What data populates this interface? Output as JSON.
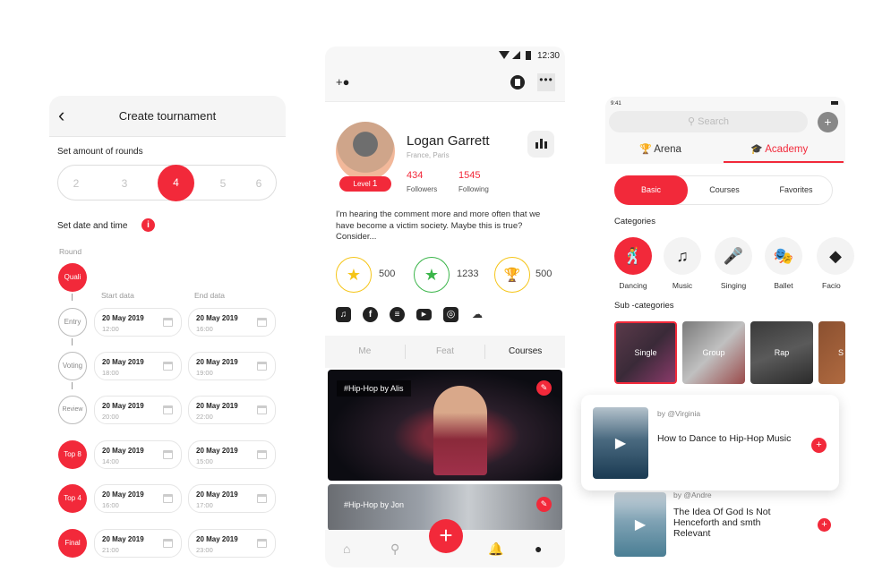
{
  "tournament": {
    "title": "Create tournament",
    "rounds_label": "Set amount of rounds",
    "round_options": [
      "2",
      "3",
      "4",
      "5",
      "6"
    ],
    "selected_rounds": "4",
    "date_label": "Set date and time",
    "info_icon": "i",
    "round_col_label": "Round",
    "start_col_label": "Start data",
    "end_col_label": "End data",
    "rounds": [
      {
        "name": "Quali",
        "style": "filled"
      },
      {
        "name": "Entry",
        "style": "outline",
        "start_date": "20 May 2019",
        "start_time": "12:00",
        "end_date": "20 May 2019",
        "end_time": "16:00"
      },
      {
        "name": "Voting",
        "style": "outline",
        "start_date": "20 May 2019",
        "start_time": "18:00",
        "end_date": "20 May 2019",
        "end_time": "19:00"
      },
      {
        "name": "Review",
        "style": "outline",
        "start_date": "20 May 2019",
        "start_time": "20:00",
        "end_date": "20 May 2019",
        "end_time": "22:00"
      },
      {
        "name": "Top 8",
        "style": "filled",
        "start_date": "20 May 2019",
        "start_time": "14:00",
        "end_date": "20 May 2019",
        "end_time": "15:00"
      },
      {
        "name": "Top 4",
        "style": "filled",
        "start_date": "20 May 2019",
        "start_time": "16:00",
        "end_date": "20 May 2019",
        "end_time": "17:00"
      },
      {
        "name": "Final",
        "style": "filled",
        "start_date": "20 May 2019",
        "start_time": "21:00",
        "end_date": "20 May 2019",
        "end_time": "23:00"
      }
    ]
  },
  "profile": {
    "status_time": "12:30",
    "name": "Logan Garrett",
    "location": "France, Paris",
    "level_label": "Level",
    "level_value": "1",
    "followers_count": "434",
    "followers_label": "Followers",
    "following_count": "1545",
    "following_label": "Following",
    "bio": "I'm hearing the comment more and more often that we have become a victim society. Maybe this is true? Consider...",
    "badges": [
      {
        "icon": "★",
        "value": "500",
        "color": "#f5c518"
      },
      {
        "icon": "★",
        "value": "1233",
        "color": "#3bb54a"
      },
      {
        "icon": "🏆",
        "value": "500",
        "color": "#f5c518"
      }
    ],
    "socials": [
      "apple-music",
      "facebook",
      "spotify",
      "youtube",
      "instagram",
      "soundcloud"
    ],
    "tabs": [
      "Me",
      "Feat",
      "Courses"
    ],
    "active_tab": "Courses",
    "posts": [
      {
        "tag": "#Hip-Hop by Alis"
      },
      {
        "tag": "#Hip-Hop by Jon"
      }
    ],
    "nav": [
      "home",
      "search",
      "add",
      "notifications",
      "profile"
    ]
  },
  "academy": {
    "status_time": "9:41",
    "search_placeholder": "Search",
    "top_tabs": [
      "Arena",
      "Academy"
    ],
    "active_top_tab": "Academy",
    "segments": [
      "Basic",
      "Courses",
      "Favorites"
    ],
    "active_segment": "Basic",
    "categories_label": "Categories",
    "categories": [
      {
        "label": "Dancing",
        "icon": "🕺"
      },
      {
        "label": "Music",
        "icon": "♫"
      },
      {
        "label": "Singing",
        "icon": "🎤"
      },
      {
        "label": "Ballet",
        "icon": "🎭"
      },
      {
        "label": "Facio",
        "icon": "◆"
      }
    ],
    "subcategories_label": "Sub -categories",
    "subcategories": [
      "Single",
      "Group",
      "Rap",
      "S"
    ],
    "videos": [
      {
        "author": "by @Virginia",
        "title": "How to Dance to Hip-Hop Music"
      },
      {
        "author": "by @Andre",
        "title": "The Idea Of God Is Not Henceforth and smth Relevant"
      }
    ],
    "accent_color": "#f2293a"
  }
}
